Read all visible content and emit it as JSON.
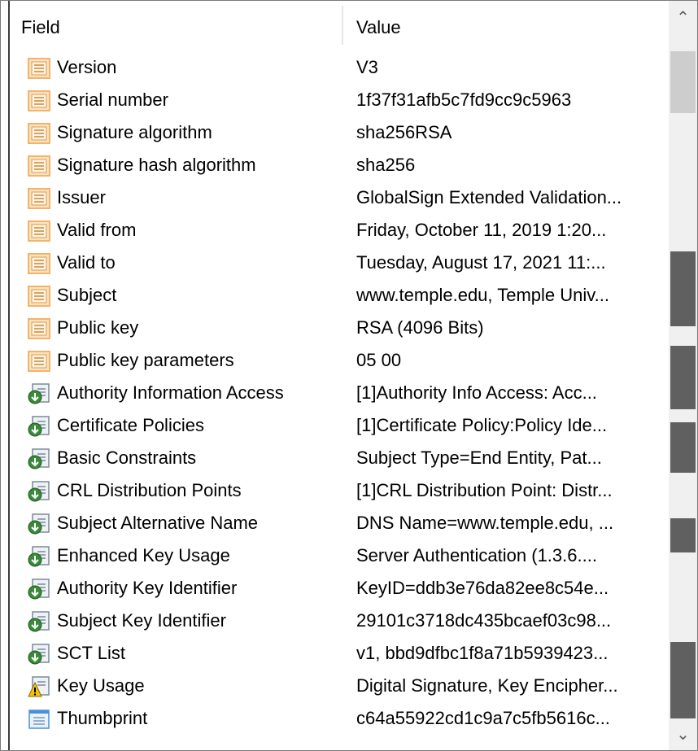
{
  "header": {
    "field_label": "Field",
    "value_label": "Value"
  },
  "rows": [
    {
      "icon": "certificate-field-icon",
      "field": "Version",
      "value": "V3"
    },
    {
      "icon": "certificate-field-icon",
      "field": "Serial number",
      "value": "1f37f31afb5c7fd9cc9c5963"
    },
    {
      "icon": "certificate-field-icon",
      "field": "Signature algorithm",
      "value": "sha256RSA"
    },
    {
      "icon": "certificate-field-icon",
      "field": "Signature hash algorithm",
      "value": "sha256"
    },
    {
      "icon": "certificate-field-icon",
      "field": "Issuer",
      "value": "GlobalSign Extended Validation..."
    },
    {
      "icon": "certificate-field-icon",
      "field": "Valid from",
      "value": "Friday, October 11, 2019 1:20..."
    },
    {
      "icon": "certificate-field-icon",
      "field": "Valid to",
      "value": "Tuesday, August 17, 2021 11:..."
    },
    {
      "icon": "certificate-field-icon",
      "field": "Subject",
      "value": "www.temple.edu, Temple Univ..."
    },
    {
      "icon": "certificate-field-icon",
      "field": "Public key",
      "value": "RSA (4096 Bits)"
    },
    {
      "icon": "certificate-field-icon",
      "field": "Public key parameters",
      "value": "05 00"
    },
    {
      "icon": "extension-icon",
      "field": "Authority Information Access",
      "value": "[1]Authority Info Access: Acc..."
    },
    {
      "icon": "extension-icon",
      "field": "Certificate Policies",
      "value": "[1]Certificate Policy:Policy Ide..."
    },
    {
      "icon": "extension-icon",
      "field": "Basic Constraints",
      "value": "Subject Type=End Entity, Pat..."
    },
    {
      "icon": "extension-icon",
      "field": "CRL Distribution Points",
      "value": "[1]CRL Distribution Point: Distr..."
    },
    {
      "icon": "extension-icon",
      "field": "Subject Alternative Name",
      "value": "DNS Name=www.temple.edu, ..."
    },
    {
      "icon": "extension-icon",
      "field": "Enhanced Key Usage",
      "value": "Server Authentication (1.3.6...."
    },
    {
      "icon": "extension-icon",
      "field": "Authority Key Identifier",
      "value": "KeyID=ddb3e76da82ee8c54e..."
    },
    {
      "icon": "extension-icon",
      "field": "Subject Key Identifier",
      "value": "29101c3718dc435bcaef03c98..."
    },
    {
      "icon": "extension-icon",
      "field": "SCT List",
      "value": "v1, bbd9dfbc1f8a71b5939423..."
    },
    {
      "icon": "critical-extension-warning-icon",
      "field": "Key Usage",
      "value": "Digital Signature, Key Encipher..."
    },
    {
      "icon": "thumbprint-icon",
      "field": "Thumbprint",
      "value": "c64a55922cd1c9a7c5fb5616c..."
    }
  ],
  "scrollbar": {
    "up_icon": "chevron-up-icon",
    "down_icon": "chevron-down-icon"
  },
  "colors": {
    "cert_icon": "#f2b36a",
    "extension_icon": "#3a8a3a",
    "warning": "#f4c20d",
    "thumbprint_icon": "#4a90d9",
    "scroll_marker": "#606060"
  }
}
